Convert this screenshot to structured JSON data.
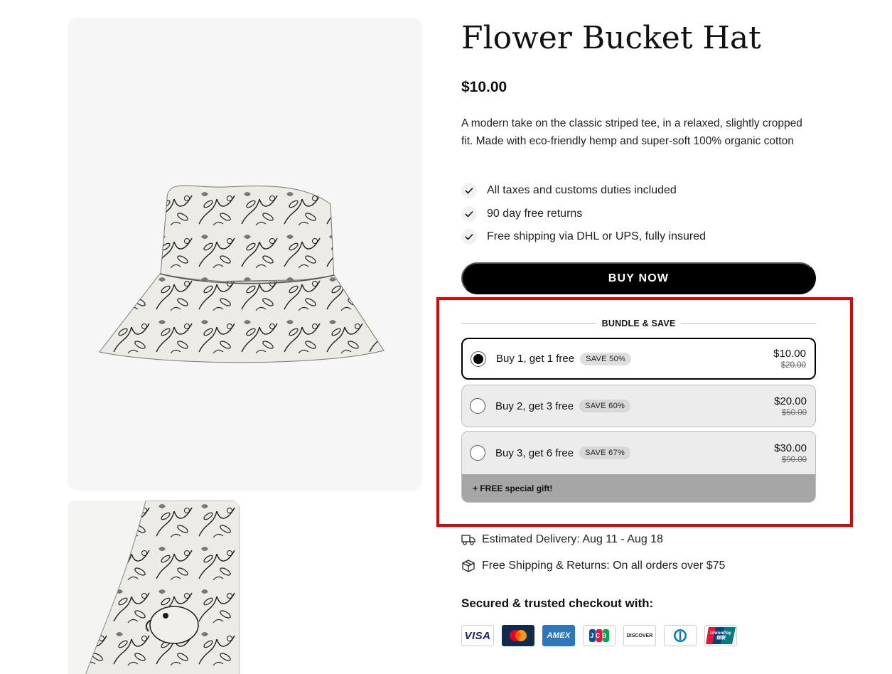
{
  "product": {
    "title": "Flower Bucket Hat",
    "price": "$10.00",
    "description": "A modern take on the classic striped tee, in a relaxed, slightly cropped fit. Made with eco-friendly hemp and super-soft 100% organic cotton"
  },
  "benefits": [
    {
      "label": "All taxes and customs duties included",
      "icon": "check-icon"
    },
    {
      "label": "90 day free returns",
      "icon": "check-icon"
    },
    {
      "label": "Free shipping via DHL or UPS, fully insured",
      "icon": "check-icon"
    }
  ],
  "buy_button": {
    "label": "BUY NOW"
  },
  "bundle": {
    "header": "BUNDLE & SAVE",
    "options": [
      {
        "title": "Buy 1, get 1 free",
        "badge": "SAVE 50%",
        "price": "$10.00",
        "compare_price": "$20.00",
        "selected": true
      },
      {
        "title": "Buy 2, get 3 free",
        "badge": "SAVE 60%",
        "price": "$20.00",
        "compare_price": "$50.00",
        "selected": false
      },
      {
        "title": "Buy 3, get 6 free",
        "badge": "SAVE 67%",
        "price": "$30.00",
        "compare_price": "$90.00",
        "selected": false,
        "gift": "+ FREE special gift!"
      }
    ]
  },
  "delivery": {
    "estimated": {
      "icon": "truck-icon",
      "text": "Estimated Delivery: Aug 11 - Aug 18"
    },
    "shipping": {
      "icon": "package-icon",
      "text": "Free Shipping & Returns: On all orders over $75"
    }
  },
  "checkout": {
    "title": "Secured & trusted checkout with:",
    "payment_methods": [
      {
        "name": "visa",
        "label": "VISA",
        "bg": "#ffffff",
        "fg": "#1a1f71"
      },
      {
        "name": "mastercard",
        "label": "",
        "bg": "#0f2a4a",
        "fg": "#ffffff"
      },
      {
        "name": "amex",
        "label": "AMEX",
        "bg": "#2e77bc",
        "fg": "#ffffff"
      },
      {
        "name": "jcb",
        "label": "JCB",
        "bg": "#ffffff",
        "fg": "#0b4ea2"
      },
      {
        "name": "discover",
        "label": "DISCOVER",
        "bg": "#ffffff",
        "fg": "#222222"
      },
      {
        "name": "diners",
        "label": "",
        "bg": "#ffffff",
        "fg": "#0079be"
      },
      {
        "name": "unionpay",
        "label": "UnionPay 银联",
        "bg": "#e21836",
        "fg": "#ffffff"
      }
    ]
  },
  "colors": {
    "highlight_border": "#e60000",
    "button_bg": "#000000",
    "gift_bar": "#a6a6a6",
    "option_unselected_bg": "#ececec"
  }
}
